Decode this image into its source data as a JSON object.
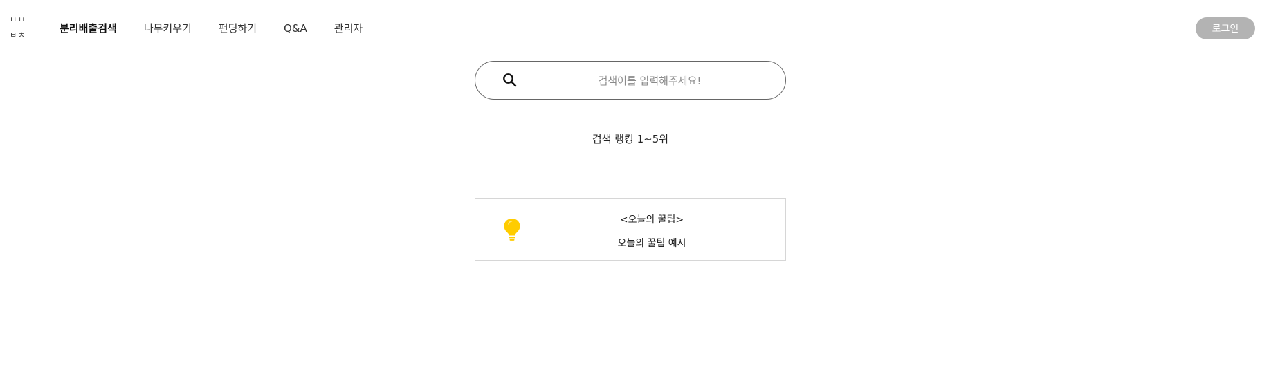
{
  "header": {
    "logo": {
      "line1": "ㅂㅂ",
      "line2": "ㅂㅊ"
    },
    "nav": [
      {
        "label": "분리배출검색",
        "active": true
      },
      {
        "label": "나무키우기",
        "active": false
      },
      {
        "label": "펀딩하기",
        "active": false
      },
      {
        "label": "Q&A",
        "active": false
      },
      {
        "label": "관리자",
        "active": false
      }
    ],
    "login_label": "로그인"
  },
  "search": {
    "placeholder": "검색어를 입력해주세요!",
    "value": "",
    "icon": "search-icon"
  },
  "ranking": {
    "label": "검색 랭킹 1~5위"
  },
  "tip": {
    "icon": "lightbulb-icon",
    "title": "<오늘의 꿀팁>",
    "body": "오늘의 꿀팁 예시"
  },
  "colors": {
    "accent_bulb": "#FFCC00",
    "login_button_bg": "#B3B3B3",
    "search_border": "#666666",
    "card_border": "#D6D6D6"
  }
}
